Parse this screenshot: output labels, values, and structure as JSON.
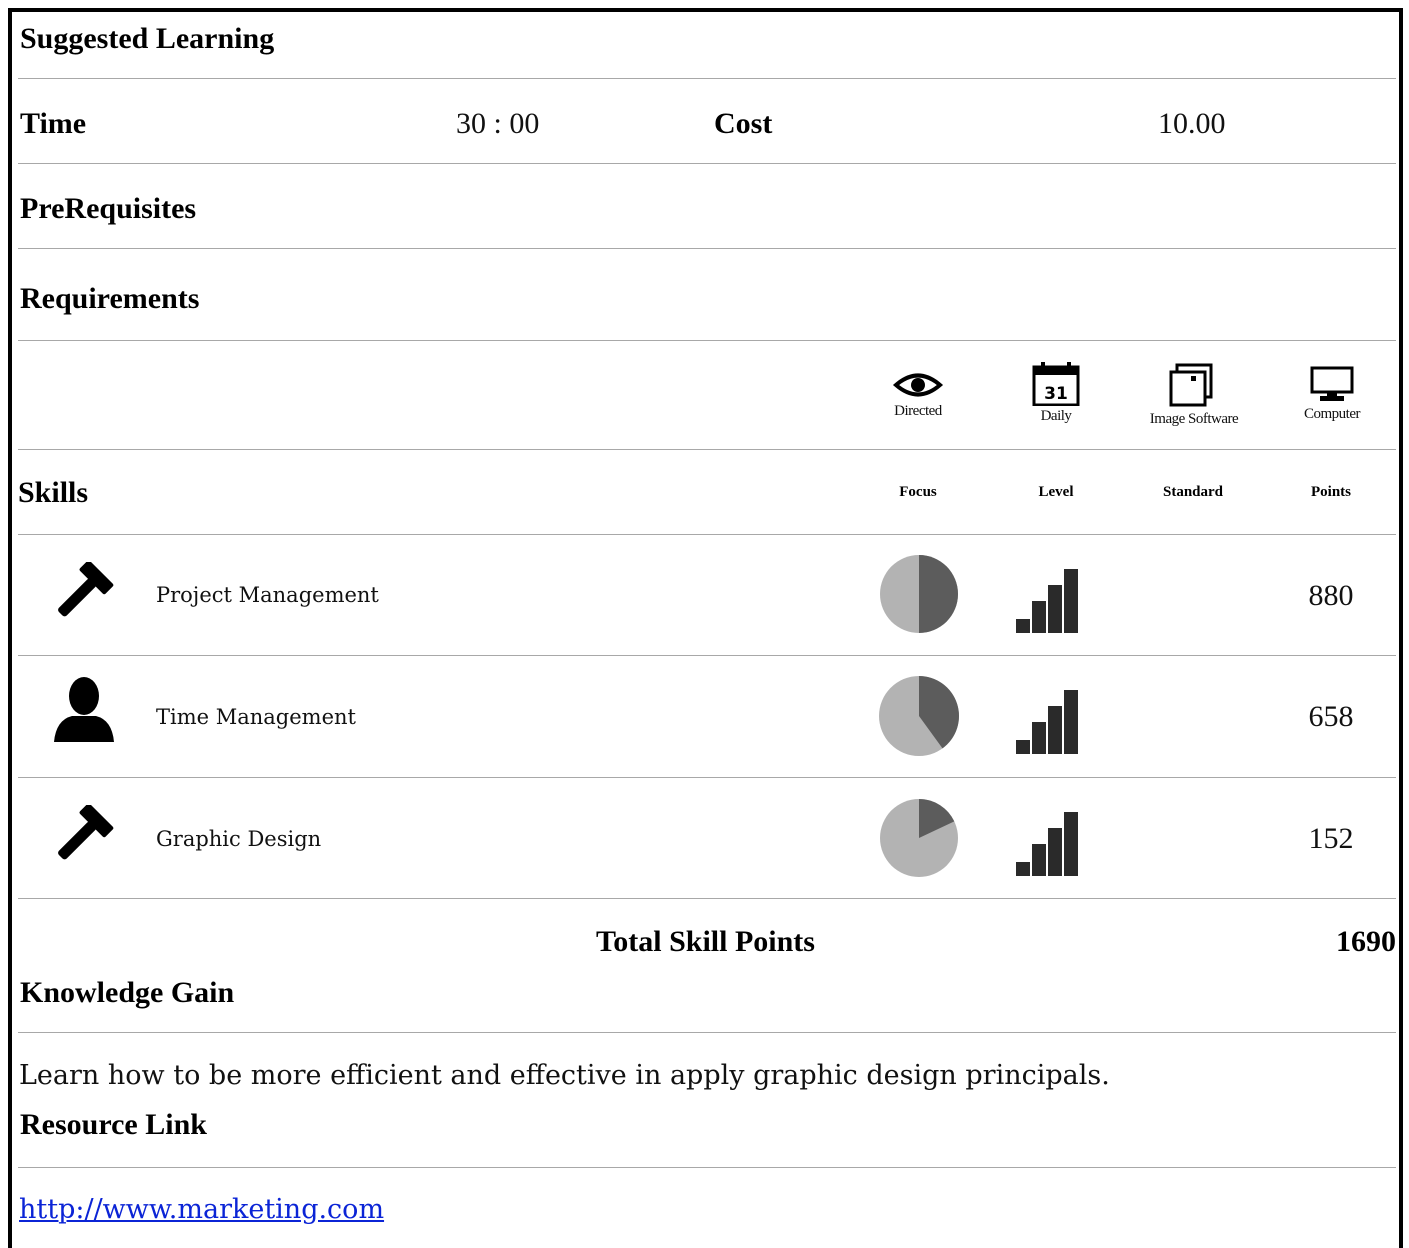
{
  "title": "Suggested Learning",
  "time": {
    "label": "Time",
    "value": "30 : 00"
  },
  "cost": {
    "label": "Cost",
    "value": "10.00"
  },
  "prerequisites_label": "PreRequisites",
  "requirements": {
    "label": "Requirements",
    "items": [
      {
        "icon": "eye-icon",
        "label": "Directed"
      },
      {
        "icon": "calendar-icon",
        "label": "Daily",
        "day": "31"
      },
      {
        "icon": "image-software-icon",
        "label": "Image Software"
      },
      {
        "icon": "computer-icon",
        "label": "Computer"
      }
    ]
  },
  "skills": {
    "label": "Skills",
    "columns": [
      "Focus",
      "Level",
      "Standard",
      "Points"
    ],
    "rows": [
      {
        "icon": "hammer-icon",
        "name": "Project Management",
        "focus": 0.5,
        "level": 4,
        "points": "880"
      },
      {
        "icon": "person-icon",
        "name": "Time Management",
        "focus": 0.4,
        "level": 4,
        "points": "658"
      },
      {
        "icon": "hammer-icon",
        "name": "Graphic Design",
        "focus": 0.18,
        "level": 4,
        "points": "152"
      }
    ]
  },
  "total": {
    "label": "Total Skill Points",
    "value": "1690"
  },
  "knowledge": {
    "label": "Knowledge Gain",
    "text": "Learn how to be more efficient and effective in apply graphic design principals."
  },
  "resource": {
    "label": "Resource Link",
    "url": "http://www.marketing.com"
  },
  "colors": {
    "pie_light": "#b3b3b3",
    "pie_dark": "#5c5c5c",
    "bars": "#2a2a2a",
    "link": "#0b24d6"
  }
}
